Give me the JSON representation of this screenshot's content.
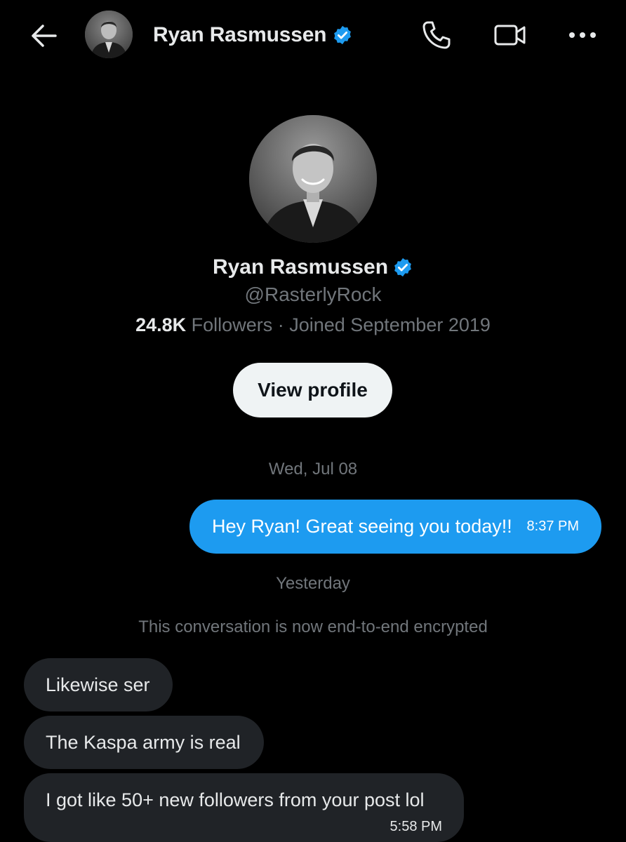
{
  "header": {
    "name": "Ryan Rasmussen",
    "back_icon": "arrow-left-icon",
    "verified_icon": "verified-badge-icon",
    "call_icon": "phone-icon",
    "video_icon": "video-camera-icon",
    "more_icon": "more-horizontal-icon"
  },
  "profile": {
    "name": "Ryan Rasmussen",
    "handle": "@RasterlyRock",
    "followers_count": "24.8K",
    "followers_label": "Followers · Joined September 2019",
    "view_profile_label": "View profile"
  },
  "conversation": {
    "date_separator_1": "Wed, Jul 08",
    "outgoing": [
      {
        "text": "Hey Ryan! Great seeing you today!!",
        "time": "8:37 PM"
      }
    ],
    "date_separator_2": "Yesterday",
    "encryption_notice": "This conversation is now end-to-end encrypted",
    "incoming": [
      {
        "text": "Likewise ser"
      },
      {
        "text": "The Kaspa army is real"
      },
      {
        "text": "I got like 50+ new followers from your post lol",
        "time": "5:58 PM"
      }
    ]
  },
  "colors": {
    "background": "#000000",
    "accent_blue": "#1d9bf0",
    "incoming_bubble": "#202327",
    "secondary_text": "#71767b",
    "primary_text": "#e7e9ea",
    "button_bg": "#eff3f4"
  }
}
